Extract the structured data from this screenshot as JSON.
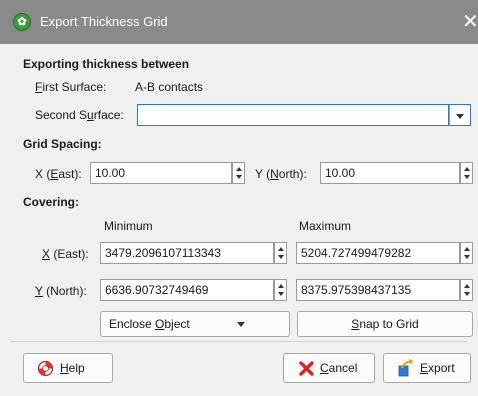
{
  "window": {
    "title": "Export Thickness Grid",
    "close_glyph": "✕",
    "app_icon": "leapfrog-app-icon"
  },
  "exporting": {
    "heading": "Exporting thickness between",
    "first_label_u": "F",
    "first_label_rest": "irst Surface:",
    "first_value": "A-B contacts",
    "second_label_pre": "Second S",
    "second_label_u": "u",
    "second_label_post": "rface:",
    "second_value": ""
  },
  "grid_spacing": {
    "heading": "Grid Spacing:",
    "x_pre": "X (",
    "x_u": "E",
    "x_post": "ast):",
    "x_value": "10.00",
    "y_pre": "Y (",
    "y_u": "N",
    "y_post": "orth):",
    "y_value": "10.00"
  },
  "covering": {
    "heading": "Covering:",
    "col_min": "Minimum",
    "col_max": "Maximum",
    "x_u": "X",
    "x_post": " (East):",
    "x_min": "3479.2096107113343",
    "x_max": "5204.727499479282",
    "y_u": "Y",
    "y_post": " (North):",
    "y_min": "6636.90732749469",
    "y_max": "8375.975398437135",
    "enclose_pre": "Enclose ",
    "enclose_u": "O",
    "enclose_post": "bject",
    "snap_u": "S",
    "snap_post": "nap to Grid"
  },
  "buttons": {
    "help_u": "H",
    "help_post": "elp",
    "cancel_u": "C",
    "cancel_post": "ancel",
    "export_u": "E",
    "export_post": "xport"
  },
  "colors": {
    "titlebar": "#8a8a8a",
    "focus_border": "#2d78c8",
    "background": "#f0f0f0"
  }
}
